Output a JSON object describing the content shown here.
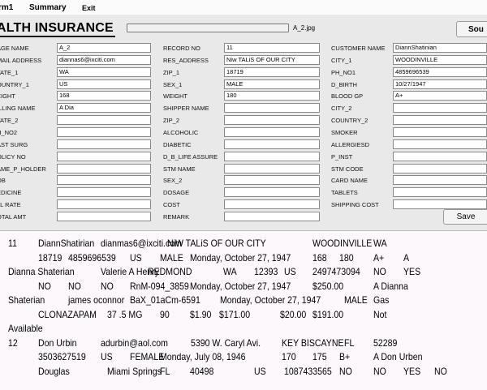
{
  "menu": [
    "rm1",
    "Summary",
    "Exit"
  ],
  "form": {
    "title": "ALTH INSURANCE",
    "image_name": "A_2.jpg",
    "source_button": "Sou",
    "save_button": "Save",
    "col1": [
      {
        "label": "AGE NAME",
        "value": "A_2"
      },
      {
        "label": "MAIL ADDRESS",
        "value": "diannas6@ixciti.com"
      },
      {
        "label": "TATE_1",
        "value": "WA"
      },
      {
        "label": "OUNTRY_1",
        "value": "US"
      },
      {
        "label": "EIGHT",
        "value": "168"
      },
      {
        "label": "ILLING NAME",
        "value": "A Dia"
      },
      {
        "label": "TATE_2",
        "value": ""
      },
      {
        "label": "H_NO2",
        "value": ""
      },
      {
        "label": "AST SURG",
        "value": ""
      },
      {
        "label": "OLICY NO",
        "value": ""
      },
      {
        "label": "AME_P_HOLDER",
        "value": ""
      },
      {
        "label": "OB",
        "value": ""
      },
      {
        "label": "EDICINE",
        "value": ""
      },
      {
        "label": "LL RATE",
        "value": ""
      },
      {
        "label": "OTAL AMT",
        "value": ""
      }
    ],
    "col2": [
      {
        "label": "RECORD NO",
        "value": "11"
      },
      {
        "label": "RES_ADDRESS",
        "value": "Niw TALiS OF OUR CITY"
      },
      {
        "label": "ZIP_1",
        "value": "18719"
      },
      {
        "label": "SEX_1",
        "value": "MALE"
      },
      {
        "label": "WEIGHT",
        "value": "180"
      },
      {
        "label": "SHIPPER NAME",
        "value": ""
      },
      {
        "label": "ZIP_2",
        "value": ""
      },
      {
        "label": "ALCOHOLIC",
        "value": ""
      },
      {
        "label": "DIABETIC",
        "value": ""
      },
      {
        "label": "D_B_LIFE ASSURE",
        "value": ""
      },
      {
        "label": "STM NAME",
        "value": ""
      },
      {
        "label": "SEX_2",
        "value": ""
      },
      {
        "label": "DOSAGE",
        "value": ""
      },
      {
        "label": "COST",
        "value": ""
      },
      {
        "label": "REMARK",
        "value": ""
      }
    ],
    "col3": [
      {
        "label": "CUSTOMER NAME",
        "value": "DiannShatinian"
      },
      {
        "label": "CITY_1",
        "value": "WOODINVILLE"
      },
      {
        "label": "PH_NO1",
        "value": "4859696539"
      },
      {
        "label": "D_BIRTH",
        "value": "10/27/1947"
      },
      {
        "label": "BLOOD GP",
        "value": "A+"
      },
      {
        "label": "CITY_2",
        "value": ""
      },
      {
        "label": "COUNTRY_2",
        "value": ""
      },
      {
        "label": "SMOKER",
        "value": ""
      },
      {
        "label": "ALLERGIESD",
        "value": ""
      },
      {
        "label": "P_INST",
        "value": ""
      },
      {
        "label": "STM CODE",
        "value": ""
      },
      {
        "label": "CARD NAME",
        "value": ""
      },
      {
        "label": "TABLETS",
        "value": ""
      },
      {
        "label": "SHIPPING COST",
        "value": ""
      }
    ]
  },
  "data_lines": [
    [
      "11",
      "DiannShatirian",
      "dianmas6@ixciti.com",
      "NiW TALiS OF OUR CITY",
      "WOODINVILLE",
      "WA"
    ],
    [
      "18719",
      "4859696539",
      "US",
      "MALE",
      "Monday, October 27, 1947",
      "168",
      "180",
      "A+",
      "A"
    ],
    [
      "Dianna Shaterian",
      "Valerie A Henry",
      "REDMOND",
      "WA",
      "12393",
      "US",
      "2497473094",
      "NO",
      "YES"
    ],
    [
      "NO",
      "NO",
      "NO",
      "RnM-094_3859",
      "Monday, October 27, 1947",
      "$250.00",
      "A Dianna"
    ],
    [
      "Shaterian",
      "james oconnor",
      "BaX_01aCm-6591",
      "Monday, October 27, 1947",
      "MALE",
      "Gas"
    ],
    [
      "CLONAZAPAM",
      "37 .5 MG",
      "90",
      "$1.90",
      "$171.00",
      "$20.00",
      "$191.00",
      "Not"
    ],
    [
      "Available"
    ],
    [
      "12",
      "Don Urbin",
      "adurbin@aol.com",
      "5390 W. Caryl Avi.",
      "KEY BISCAYNE",
      "FL",
      "52289"
    ],
    [
      "3503627519",
      "US",
      "FEMALE",
      "Monday, July 08, 1946",
      "170",
      "175",
      "B+",
      "A Don Urben"
    ],
    [
      "Douglas",
      "Miami Springs",
      "FL",
      "40498",
      "US",
      "1087433565",
      "NO",
      "NO",
      "YES",
      "NO"
    ]
  ]
}
